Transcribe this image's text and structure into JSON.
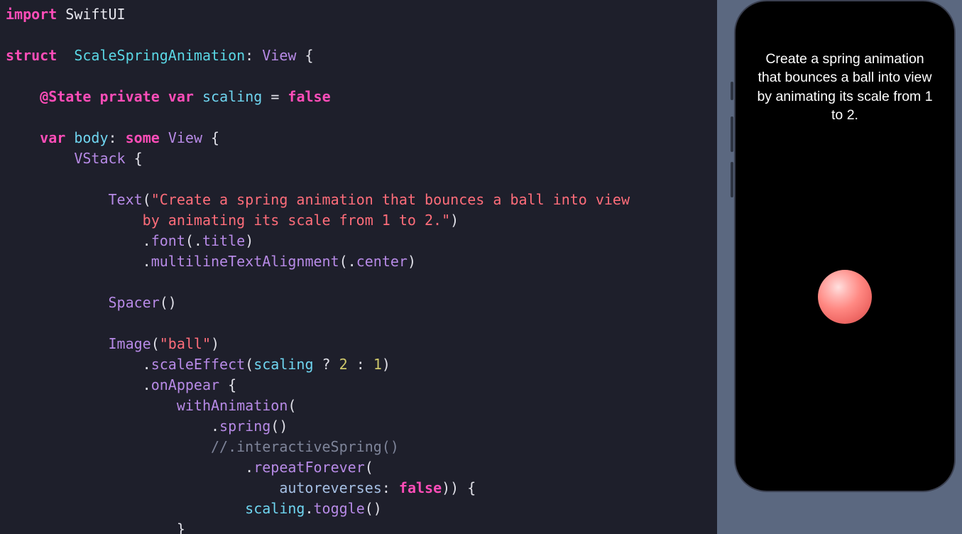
{
  "code": {
    "kw_import": "import",
    "swiftui": "SwiftUI",
    "kw_struct": "struct",
    "type_name": "ScaleSpringAnimation",
    "protocol": "View",
    "attr_state": "@State",
    "kw_private": "private",
    "kw_var1": "var",
    "prop_scaling": "scaling",
    "kw_false": "false",
    "kw_var2": "var",
    "prop_body": "body",
    "kw_some": "some",
    "type_view": "View",
    "fn_vstack": "VStack",
    "fn_text": "Text",
    "str_text": "\"Create a spring animation that bounces a ball into view\n                by animating its scale from 1 to 2.\"",
    "mod_font": "font",
    "enum_title": "title",
    "mod_mta": "multilineTextAlignment",
    "enum_center": "center",
    "fn_spacer": "Spacer",
    "fn_image": "Image",
    "str_ball": "\"ball\"",
    "mod_scale": "scaleEffect",
    "expr_scaling": "scaling",
    "num_2": "2",
    "num_1": "1",
    "mod_onappear": "onAppear",
    "fn_withanim": "withAnimation",
    "fn_spring": "spring",
    "comment_ispring": "//.interactiveSpring()",
    "fn_repeat": "repeatForever",
    "param_autorev": "autoreverses",
    "kw_false2": "false",
    "expr_toggle_target": "scaling",
    "fn_toggle": "toggle"
  },
  "preview": {
    "title_text": "Create a spring animation that bounces a ball into view by animating its scale from 1 to 2."
  }
}
